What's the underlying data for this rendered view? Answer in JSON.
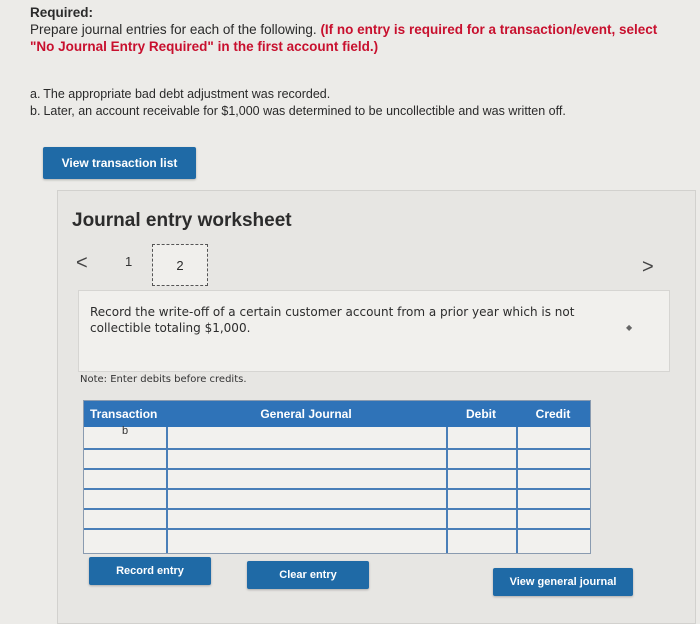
{
  "instructions": {
    "title": "Required:",
    "text": "Prepare journal entries for each of the following.",
    "note": "(If no entry is required for a transaction/event, select \"No Journal Entry Required\" in the first account field.)"
  },
  "transactions": [
    {
      "key": "a.",
      "text": "The appropriate bad debt adjustment was recorded."
    },
    {
      "key": "b.",
      "text": "Later, an account receivable for $1,000 was determined to be uncollectible and was written off."
    }
  ],
  "buttons": {
    "view_list": "View transaction list",
    "record": "Record entry",
    "clear": "Clear entry",
    "view_journal": "View general journal"
  },
  "worksheet": {
    "title": "Journal entry worksheet",
    "steps": [
      "1",
      "2"
    ],
    "nav_prev": "<",
    "nav_next": ">",
    "description": "Record the write-off of a certain customer account from a prior year which is not collectible totaling $1,000.",
    "note": "Note: Enter debits before credits."
  },
  "table": {
    "headers": [
      "Transaction",
      "General Journal",
      "Debit",
      "Credit"
    ],
    "rows": [
      {
        "transaction": "b",
        "account": "",
        "debit": "",
        "credit": ""
      },
      {
        "transaction": "",
        "account": "",
        "debit": "",
        "credit": ""
      },
      {
        "transaction": "",
        "account": "",
        "debit": "",
        "credit": ""
      },
      {
        "transaction": "",
        "account": "",
        "debit": "",
        "credit": ""
      },
      {
        "transaction": "",
        "account": "",
        "debit": "",
        "credit": ""
      },
      {
        "transaction": "",
        "account": "",
        "debit": "",
        "credit": ""
      }
    ]
  },
  "colors": {
    "button_blue": "#1f6aa6",
    "header_blue": "#2f73b8",
    "instruction_red": "#c8102e"
  }
}
